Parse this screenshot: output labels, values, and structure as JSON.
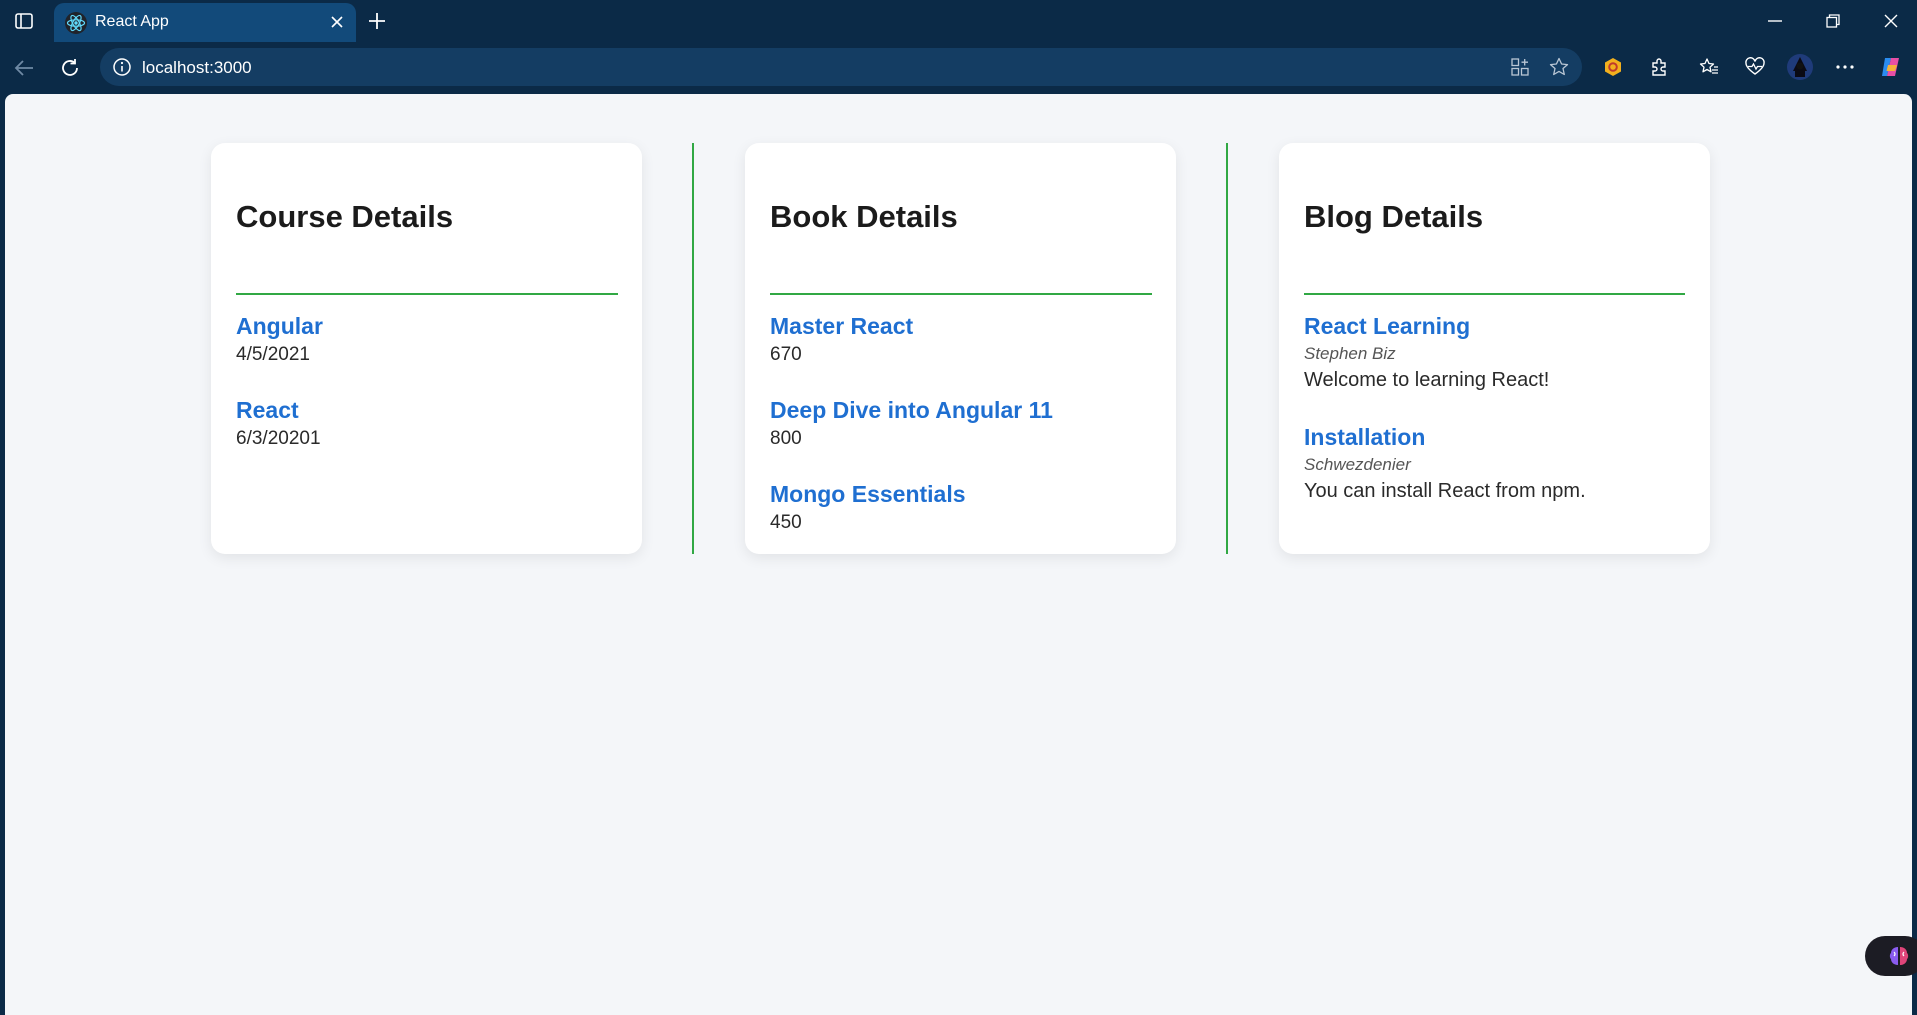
{
  "browser": {
    "tab_title": "React App",
    "address": "localhost:3000",
    "colors": {
      "frame": "#0b2a47",
      "active_tab": "#124a7a",
      "address_bar": "#143d63"
    }
  },
  "page": {
    "accent_color": "#31a844",
    "link_color": "#1f6fd1",
    "course": {
      "title": "Course Details",
      "items": [
        {
          "name": "Angular",
          "date": "4/5/2021"
        },
        {
          "name": "React",
          "date": "6/3/20201"
        }
      ]
    },
    "book": {
      "title": "Book Details",
      "items": [
        {
          "name": "Master React",
          "price": "670"
        },
        {
          "name": "Deep Dive into Angular 11",
          "price": "800"
        },
        {
          "name": "Mongo Essentials",
          "price": "450"
        }
      ]
    },
    "blog": {
      "title": "Blog Details",
      "items": [
        {
          "title": "React Learning",
          "author": "Stephen Biz",
          "content": "Welcome to learning React!"
        },
        {
          "title": "Installation",
          "author": "Schwezdenier",
          "content": "You can install React from npm."
        }
      ]
    }
  }
}
